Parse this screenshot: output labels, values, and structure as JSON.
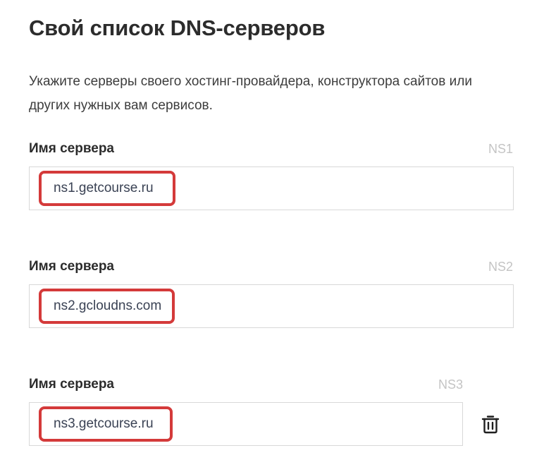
{
  "header": {
    "title": "Свой список DNS-серверов"
  },
  "description": {
    "text": "Укажите серверы своего хостинг-провайдера, конструктора сайтов или других нужных вам сервисов."
  },
  "servers": [
    {
      "label": "Имя сервера",
      "tag": "NS1",
      "value": "ns1.getcourse.ru"
    },
    {
      "label": "Имя сервера",
      "tag": "NS2",
      "value": "ns2.gcloudns.com"
    },
    {
      "label": "Имя сервера",
      "tag": "NS3",
      "value": "ns3.getcourse.ru"
    }
  ],
  "icons": {
    "delete": "trash-icon"
  },
  "colors": {
    "highlight": "#d43a3a",
    "border": "#d8d8d8",
    "tag": "#c4c4c4"
  }
}
